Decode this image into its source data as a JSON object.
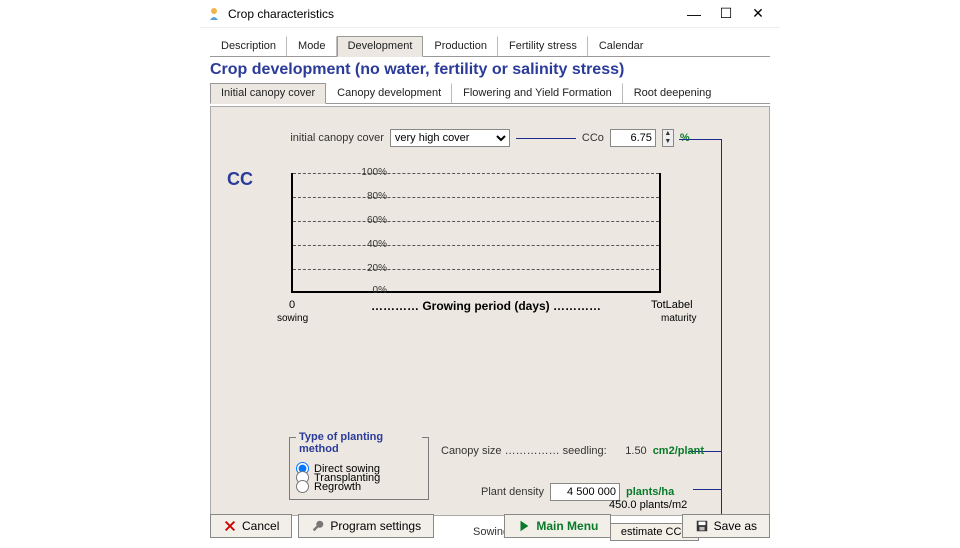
{
  "window": {
    "title": "Crop characteristics"
  },
  "tabs_top": [
    "Description",
    "Mode",
    "Development",
    "Production",
    "Fertility stress",
    "Calendar"
  ],
  "tabs_top_active": 2,
  "heading": "Crop development (no water, fertility or salinity stress)",
  "tabs_sub": [
    "Initial canopy cover",
    "Canopy development",
    "Flowering and Yield Formation",
    "Root deepening"
  ],
  "tabs_sub_active": 0,
  "icc": {
    "label": "initial canopy cover",
    "select_value": "very high cover",
    "cco_label": "CCo",
    "cco_value": "6.75",
    "unit": "%"
  },
  "chart_data": {
    "type": "line",
    "title": "",
    "y_label": "CC",
    "y_ticks": [
      "100%",
      "80%",
      "60%",
      "40%",
      "20%",
      "0%"
    ],
    "ylim": [
      0,
      100
    ],
    "x_left_value": "0",
    "x_left_label": "sowing",
    "x_title": "…………  Growing period (days)  …………",
    "x_right_value": "TotLabel",
    "x_right_label": "maturity",
    "series": []
  },
  "planting": {
    "group_title": "Type of planting method",
    "options": [
      "Direct sowing",
      "Transplanting",
      "Regrowth"
    ],
    "selected": 0
  },
  "canopy_size": {
    "label": "Canopy size  ……………  seedling:",
    "value": "1.50",
    "unit": "cm2/plant"
  },
  "plant_density": {
    "label": "Plant density",
    "value": "4 500 000",
    "unit": "plants/ha",
    "sub_value": "450.0 plants/m2"
  },
  "sowing": {
    "label": "Sowing/Planting",
    "button": "estimate CCo"
  },
  "footer": {
    "cancel": "Cancel",
    "program_settings": "Program settings",
    "main_menu": "Main Menu",
    "save_as": "Save as"
  }
}
